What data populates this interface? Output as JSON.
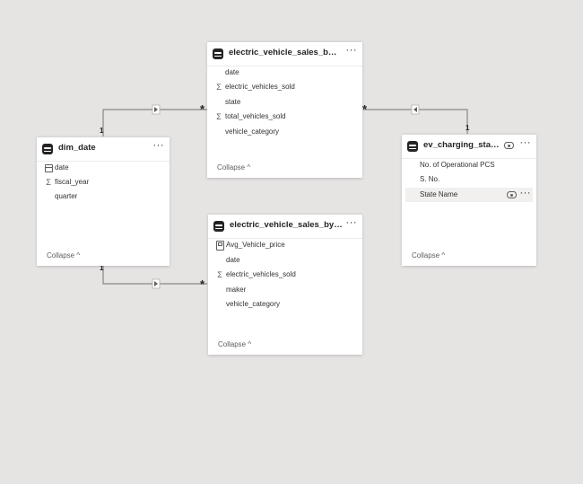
{
  "tables": {
    "dim_date": {
      "title": "dim_date",
      "fields": [
        {
          "name": "date",
          "icon": "calendar-icon"
        },
        {
          "name": "fiscal_year",
          "icon": "sigma-icon"
        },
        {
          "name": "quarter",
          "icon": ""
        }
      ],
      "collapse": "Collapse ^"
    },
    "ev_state": {
      "title": "electric_vehicle_sales_by_state",
      "fields": [
        {
          "name": "date",
          "icon": ""
        },
        {
          "name": "electric_vehicles_sold",
          "icon": "sigma-icon"
        },
        {
          "name": "state",
          "icon": ""
        },
        {
          "name": "total_vehicles_sold",
          "icon": "sigma-icon"
        },
        {
          "name": "vehicle_category",
          "icon": ""
        }
      ],
      "collapse": "Collapse ^"
    },
    "ev_maker": {
      "title": "electric_vehicle_sales_by_mak...",
      "fields": [
        {
          "name": "Avg_Vehicle_price",
          "icon": "calculator-icon"
        },
        {
          "name": "date",
          "icon": ""
        },
        {
          "name": "electric_vehicles_sold",
          "icon": "sigma-icon"
        },
        {
          "name": "maker",
          "icon": ""
        },
        {
          "name": "vehicle_category",
          "icon": ""
        }
      ],
      "collapse": "Collapse ^"
    },
    "ev_charging": {
      "title": "ev_charging_stations",
      "fields": [
        {
          "name": "No. of Operational PCS",
          "icon": ""
        },
        {
          "name": "S. No.",
          "icon": ""
        },
        {
          "name": "State Name",
          "icon": ""
        }
      ],
      "collapse": "Collapse ^"
    }
  },
  "relationships": [
    {
      "from": "dim_date",
      "to": "electric_vehicle_sales_by_state",
      "from_card": "1",
      "to_card": "*"
    },
    {
      "from": "dim_date",
      "to": "electric_vehicle_sales_by_maker",
      "from_card": "1",
      "to_card": "*"
    },
    {
      "from": "ev_charging_stations",
      "to": "electric_vehicle_sales_by_state",
      "from_card": "1",
      "to_card": "*"
    }
  ],
  "icons": {
    "more": "more-options-icon",
    "visibility": "eye-icon",
    "table": "table-icon"
  }
}
